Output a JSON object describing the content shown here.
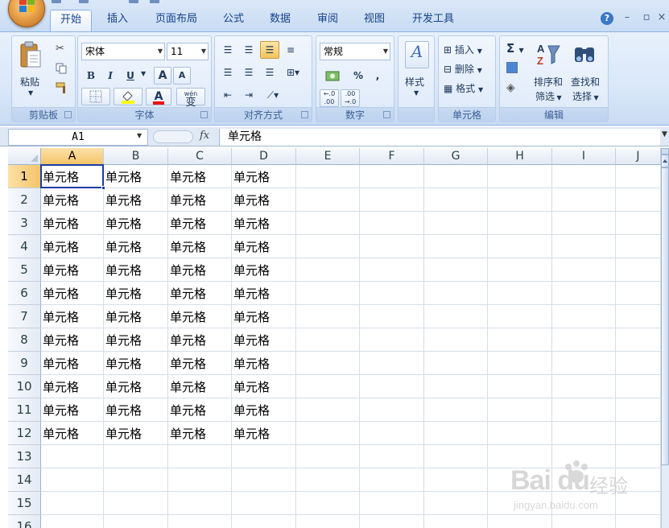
{
  "tabs": [
    "开始",
    "插入",
    "页面布局",
    "公式",
    "数据",
    "审阅",
    "视图",
    "开发工具"
  ],
  "active_tab": "开始",
  "window": {
    "help": "?",
    "minimize": "–",
    "restore": "▫",
    "close": "×"
  },
  "ribbon": {
    "clipboard": {
      "label": "剪贴板",
      "paste": "粘贴"
    },
    "font": {
      "label": "字体",
      "name": "宋体",
      "size": "11",
      "bold": "B",
      "italic": "I",
      "underline": "U",
      "grow": "A",
      "shrink": "A",
      "color_letter": "A",
      "wen": "wén",
      "wen_char": "变"
    },
    "alignment": {
      "label": "对齐方式"
    },
    "number": {
      "label": "数字",
      "format": "常规",
      "percent": "%",
      "comma": ",",
      "inc": "←.0\n.00",
      "dec": ".00\n→.0",
      "inc_label": "+.0",
      "dec_label": ".00"
    },
    "styles": {
      "label": "样式"
    },
    "cells": {
      "label": "单元格",
      "insert": "插入",
      "delete": "删除",
      "format": "格式"
    },
    "editing": {
      "label": "编辑",
      "sum": "Σ",
      "sort_1": "排序和",
      "sort_2": "筛选",
      "find_1": "查找和",
      "find_2": "选择"
    }
  },
  "formula_bar": {
    "name_box": "A1",
    "fx": "fx",
    "content": "单元格"
  },
  "sheet": {
    "columns": [
      "A",
      "B",
      "C",
      "D",
      "E",
      "F",
      "G",
      "H",
      "I",
      "J"
    ],
    "rows": [
      "1",
      "2",
      "3",
      "4",
      "5",
      "6",
      "7",
      "8",
      "9",
      "10",
      "11",
      "12",
      "13",
      "14",
      "15",
      "16"
    ],
    "cells": [
      [
        "单元格",
        "单元格",
        "单元格",
        "单元格"
      ],
      [
        "单元格",
        "单元格",
        "单元格",
        "单元格"
      ],
      [
        "单元格",
        "单元格",
        "单元格",
        "单元格"
      ],
      [
        "单元格",
        "单元格",
        "单元格",
        "单元格"
      ],
      [
        "单元格",
        "单元格",
        "单元格",
        "单元格"
      ],
      [
        "单元格",
        "单元格",
        "单元格",
        "单元格"
      ],
      [
        "单元格",
        "单元格",
        "单元格",
        "单元格"
      ],
      [
        "单元格",
        "单元格",
        "单元格",
        "单元格"
      ],
      [
        "单元格",
        "单元格",
        "单元格",
        "单元格"
      ],
      [
        "单元格",
        "单元格",
        "单元格",
        "单元格"
      ],
      [
        "单元格",
        "单元格",
        "单元格",
        "单元格"
      ],
      [
        "单元格",
        "单元格",
        "单元格",
        "单元格"
      ]
    ],
    "active_cell": "A1"
  },
  "watermark": {
    "brand": "Bai du",
    "cn": "经验",
    "url": "jingyan.baidu.com"
  }
}
